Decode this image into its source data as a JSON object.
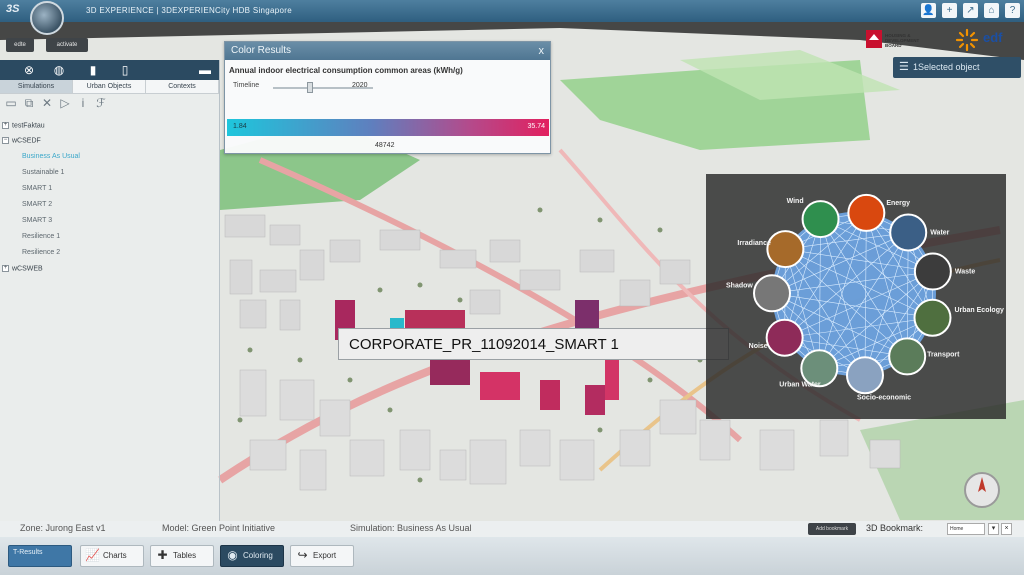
{
  "topbar": {
    "title": "3D EXPERIENCE | 3DEXPERIENCity HDB Singapore",
    "icons": [
      "person-icon",
      "plus-icon",
      "share-icon",
      "home-icon",
      "help-icon"
    ],
    "icon_glyphs": [
      "👤",
      "+",
      "↗",
      "⌂",
      "?"
    ]
  },
  "quick_buttons": {
    "left": "edte",
    "right": "activate"
  },
  "left_panel": {
    "tabs": [
      "Simulations",
      "Urban Objects",
      "Contexts"
    ],
    "active_tab": 0,
    "tree": [
      {
        "label": "testFaktau",
        "type": "root",
        "expander": "+"
      },
      {
        "label": "wCSEDF",
        "type": "root",
        "expander": "−"
      },
      {
        "label": "Business As Usual",
        "type": "child",
        "selected": true
      },
      {
        "label": "Sustainable 1",
        "type": "child"
      },
      {
        "label": "SMART 1",
        "type": "child"
      },
      {
        "label": "SMART 2",
        "type": "child"
      },
      {
        "label": "SMART 3",
        "type": "child"
      },
      {
        "label": "Resilience 1",
        "type": "child"
      },
      {
        "label": "Resilience 2",
        "type": "child"
      },
      {
        "label": "wCSWEB",
        "type": "root",
        "expander": "+"
      }
    ]
  },
  "color_results": {
    "title": "Color Results",
    "close": "x",
    "subtitle": "Annual indoor electrical consumption common areas (kWh/g)",
    "timeline_label": "Timeline",
    "timeline_year": "2020",
    "min": "1.84",
    "max": "35.74",
    "count": "48742"
  },
  "selected_object_button": "1Selected object",
  "logos": {
    "hdb": "HOUSING & DEVELOPMENT BOARD",
    "edf": "edf"
  },
  "map_label": "CORPORATE_PR_11092014_SMART 1",
  "wheel": {
    "labels": [
      "Wind",
      "Energy",
      "Water",
      "Waste",
      "Urban Ecology",
      "Transport",
      "Socio-economic",
      "Urban Water",
      "Noise",
      "Shadow",
      "Irradiance"
    ],
    "colors": {
      "net": "#6fa7e8",
      "net_line": "#d9ecff"
    }
  },
  "status": {
    "zone": "Zone: Jurong East v1",
    "model": "Model: Green Point Initiative",
    "simulation": "Simulation: Business As Usual",
    "bookmark_button": "Add bookmark",
    "bookmark_label": "3D Bookmark:",
    "bookmark_value": "Home"
  },
  "toolbar": {
    "results": "T-Results",
    "buttons": [
      {
        "label": "Charts",
        "icon": "chart-icon"
      },
      {
        "label": "Tables",
        "icon": "table-icon"
      },
      {
        "label": "Coloring",
        "icon": "eye-icon"
      },
      {
        "label": "Export",
        "icon": "export-icon"
      }
    ]
  }
}
